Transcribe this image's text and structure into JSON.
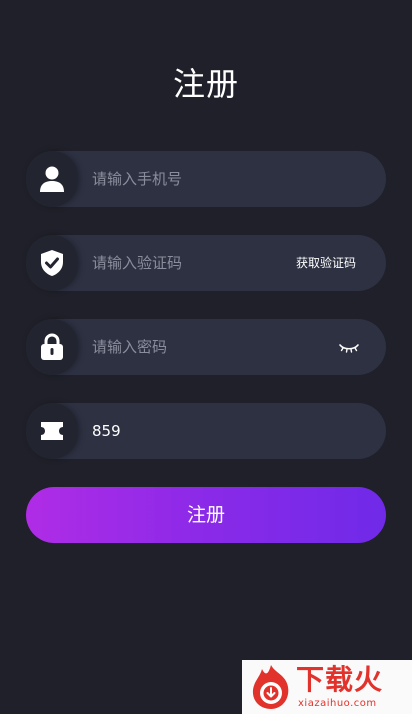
{
  "page": {
    "title": "注册"
  },
  "form": {
    "phone": {
      "placeholder": "请输入手机号",
      "value": "",
      "icon": "user-icon"
    },
    "code": {
      "placeholder": "请输入验证码",
      "value": "",
      "icon": "shield-check-icon",
      "get_code_label": "获取验证码"
    },
    "password": {
      "placeholder": "请输入密码",
      "value": "",
      "icon": "lock-icon",
      "toggle_icon": "eye-closed-icon"
    },
    "invite": {
      "placeholder": "",
      "value": "859",
      "icon": "ticket-icon"
    },
    "submit_label": "注册"
  },
  "watermark": {
    "brand": "下载火",
    "domain": "xiazaihuo.com"
  },
  "colors": {
    "background": "#1f2029",
    "field": "#2d3142",
    "icon_circle": "#22252f",
    "gradient_start": "#b02ce6",
    "gradient_end": "#6f2ae8",
    "watermark_red": "#e1322b"
  }
}
